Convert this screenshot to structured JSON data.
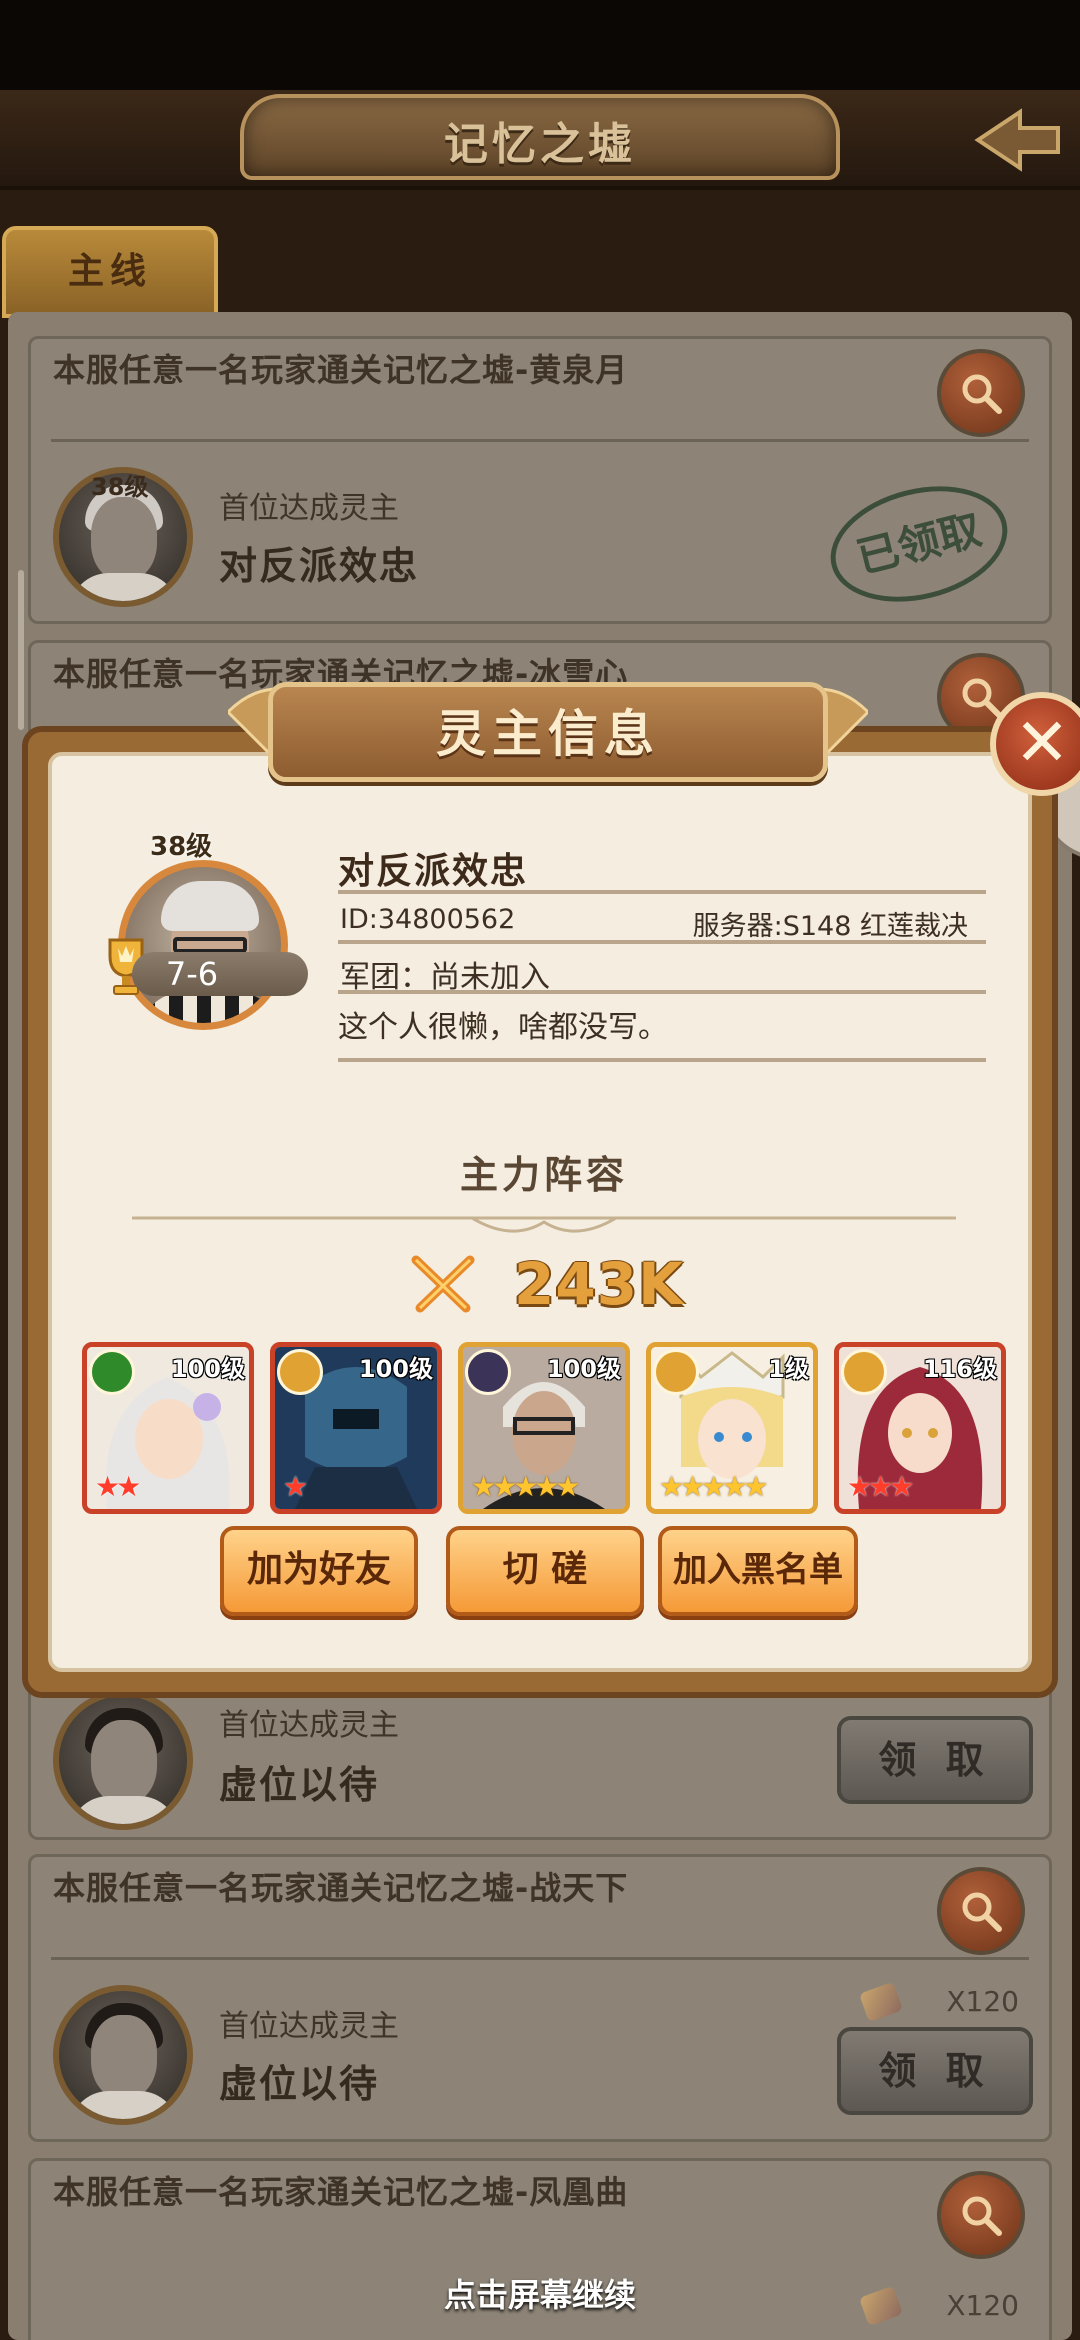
{
  "header": {
    "title": "记忆之墟"
  },
  "tabs": {
    "main": "主线"
  },
  "quests": [
    {
      "title": "本服任意一名玩家通关记忆之墟-黄泉月",
      "level": "38级",
      "subtitle": "首位达成灵主",
      "name": "对反派效忠",
      "status": "已领取"
    },
    {
      "title": "本服任意一名玩家通关记忆之墟-冰雪心"
    },
    {
      "subtitle": "首位达成灵主",
      "name": "虚位以待",
      "claim_label": "领 取"
    },
    {
      "title": "本服任意一名玩家通关记忆之墟-战天下",
      "subtitle": "首位达成灵主",
      "name": "虚位以待",
      "reward": "X120",
      "claim_label": "领 取"
    },
    {
      "title": "本服任意一名玩家通关记忆之墟-凤凰曲",
      "reward": "X120"
    }
  ],
  "modal": {
    "title": "灵主信息",
    "close_label": "✕",
    "player": {
      "level": "38级",
      "name": "对反派效忠",
      "id": "ID:34800562",
      "server": "服务器:S148 红莲裁决",
      "guild": "军团：尚未加入",
      "motto": "这个人很懒，啥都没写。",
      "rank": "7-6"
    },
    "lineup_title": "主力阵容",
    "power": "243K",
    "heroes": [
      {
        "level": "100级",
        "stars": "★★",
        "badge": "green",
        "frame": "red"
      },
      {
        "level": "100级",
        "stars": "★",
        "badge": "gold",
        "frame": "red"
      },
      {
        "level": "100级",
        "stars": "★★★★★",
        "badge": "dark",
        "frame": "gold"
      },
      {
        "level": "1级",
        "stars": "★★★★★",
        "badge": "gold",
        "frame": "gold"
      },
      {
        "level": "116级",
        "stars": "★★★",
        "badge": "gold",
        "frame": "red"
      }
    ],
    "buttons": {
      "add_friend": "加为好友",
      "spar": "切 磋",
      "blacklist": "加入黑名单"
    }
  },
  "continue_hint": "点击屏幕继续"
}
